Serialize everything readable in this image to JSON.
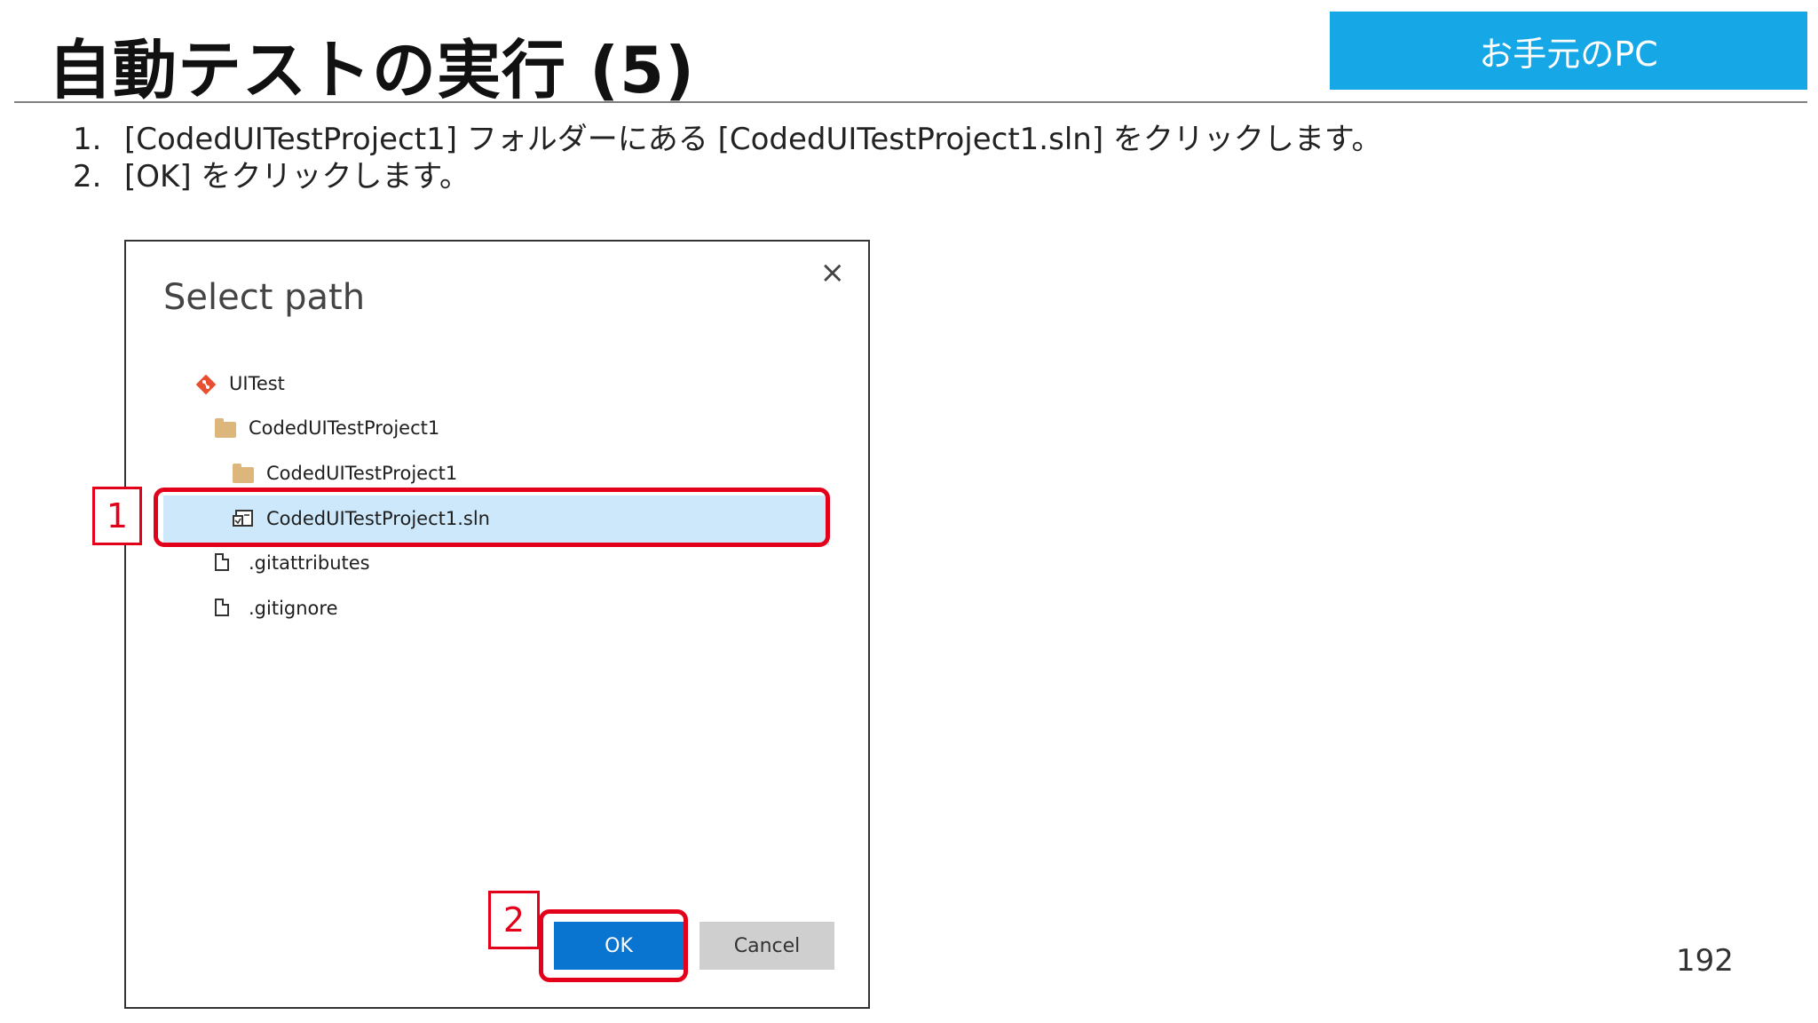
{
  "slide": {
    "title": "自動テストの実行 (5)",
    "environment_badge": "お手元のPC",
    "page_number": "192"
  },
  "steps": [
    {
      "number": "1.",
      "text": "[CodedUITestProject1] フォルダーにある [CodedUITestProject1.sln] をクリックします。"
    },
    {
      "number": "2.",
      "text": "[OK] をクリックします。"
    }
  ],
  "dialog": {
    "title": "Select path",
    "close_glyph": "×",
    "tree": [
      {
        "label": "UITest",
        "icon": "git-repo-icon"
      },
      {
        "label": "CodedUITestProject1",
        "icon": "folder-icon"
      },
      {
        "label": "CodedUITestProject1",
        "icon": "folder-icon"
      },
      {
        "label": "CodedUITestProject1.sln",
        "icon": "solution-file-icon",
        "selected": true
      },
      {
        "label": ".gitattributes",
        "icon": "file-icon"
      },
      {
        "label": ".gitignore",
        "icon": "file-icon"
      }
    ],
    "ok_label": "OK",
    "cancel_label": "Cancel"
  },
  "callouts": [
    {
      "label": "1"
    },
    {
      "label": "2"
    }
  ],
  "colors": {
    "badge": "#15a7e6",
    "callout": "#e4001a",
    "selection": "#cce8fa",
    "primary_button": "#0a74d1",
    "git_icon": "#e94e31",
    "folder": "#dcb67a"
  }
}
